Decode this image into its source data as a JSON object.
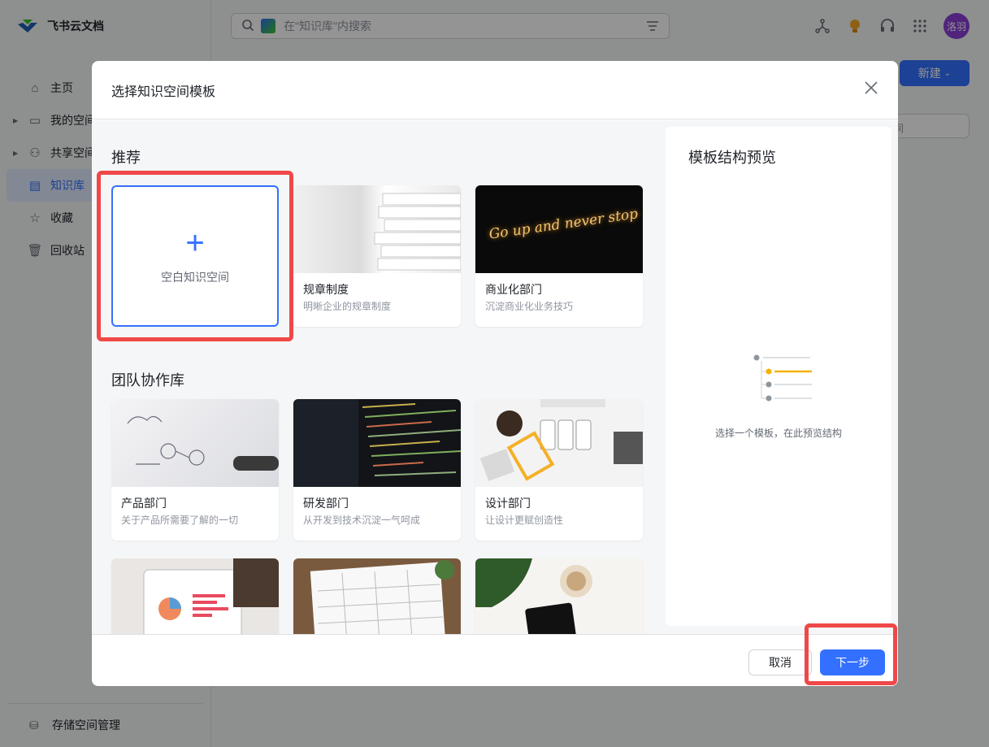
{
  "app": {
    "title": "飞书云文档"
  },
  "sidebar": {
    "items": [
      {
        "label": "主页",
        "icon": "home-icon"
      },
      {
        "label": "我的空间",
        "icon": "folder-icon"
      },
      {
        "label": "共享空间",
        "icon": "users-icon"
      },
      {
        "label": "知识库",
        "icon": "wiki-icon"
      },
      {
        "label": "收藏",
        "icon": "star-icon"
      },
      {
        "label": "回收站",
        "icon": "trash-icon"
      }
    ],
    "storage_label": "存储空间管理"
  },
  "search": {
    "placeholder": "在\"知识库\"内搜索"
  },
  "user": {
    "avatar_text": "洛羽"
  },
  "header": {
    "new_button": "新建",
    "partial_input": "间"
  },
  "modal": {
    "title": "选择知识空间模板",
    "recommend_title": "推荐",
    "team_title": "团队协作库",
    "blank_label": "空白知识空间",
    "recommended": [
      {
        "name": "规章制度",
        "desc": "明晰企业的规章制度"
      },
      {
        "name": "商业化部门",
        "desc": "沉淀商业化业务技巧"
      }
    ],
    "team": [
      {
        "name": "产品部门",
        "desc": "关于产品所需要了解的一切"
      },
      {
        "name": "研发部门",
        "desc": "从开发到技术沉淀一气呵成"
      },
      {
        "name": "设计部门",
        "desc": "让设计更赋创造性"
      }
    ],
    "preview_title": "模板结构预览",
    "preview_hint": "选择一个模板，在此预览结构",
    "cancel": "取消",
    "next": "下一步",
    "image_text": "Go up and never stop"
  },
  "colors": {
    "accent": "#3370ff",
    "highlight": "#f04848",
    "avatar": "#8b3fd6"
  }
}
